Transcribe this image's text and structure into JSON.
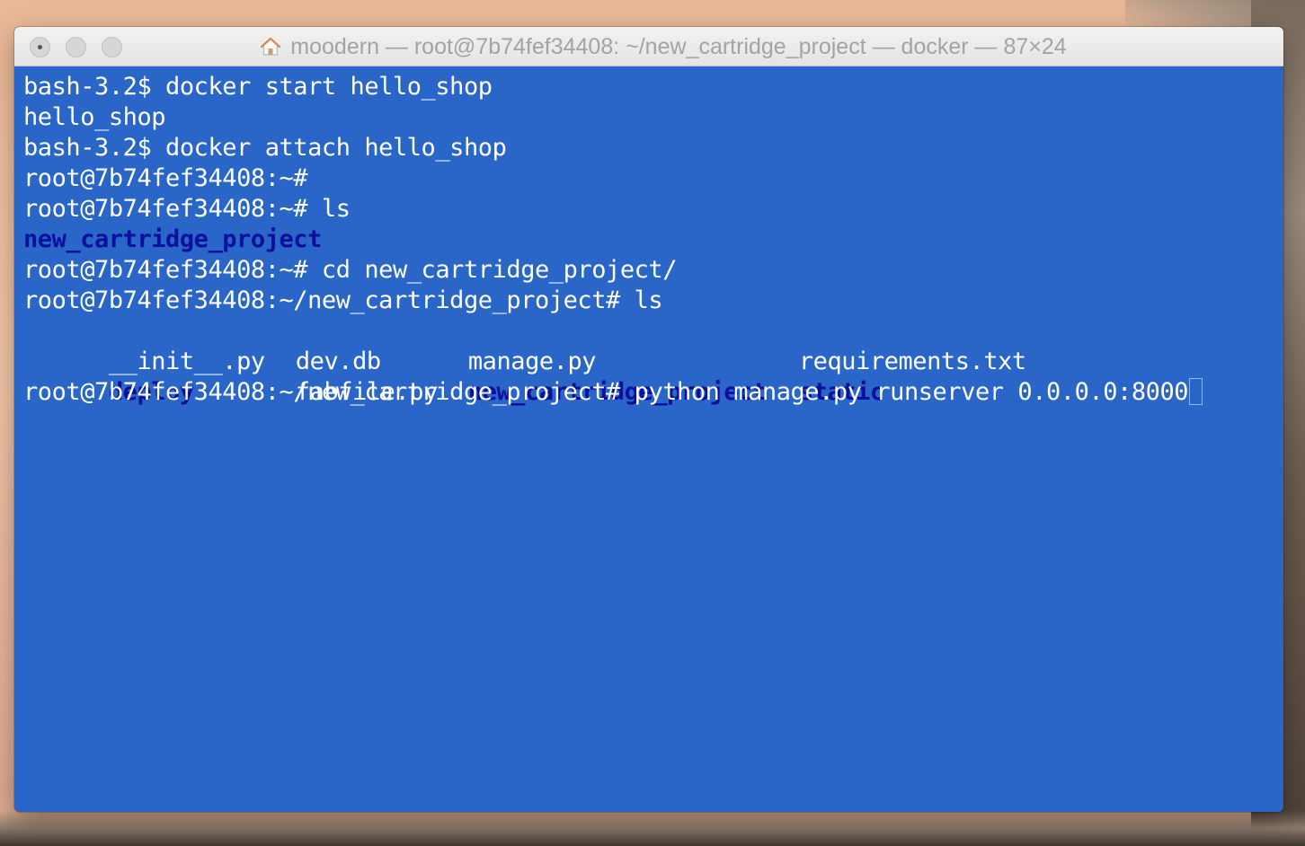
{
  "window": {
    "title": "moodern — root@7b74fef34408: ~/new_cartridge_project — docker — 87×24"
  },
  "icons": {
    "home": "home-folder-icon"
  },
  "colors": {
    "terminal_background": "#2a65c8",
    "terminal_foreground": "#ffffff",
    "directory_color": "#0a0f9e",
    "titlebar_text": "#a3a3a3"
  },
  "terminal": {
    "lines": [
      "bash-3.2$ docker start hello_shop",
      "hello_shop",
      "bash-3.2$ docker attach hello_shop",
      "root@7b74fef34408:~#",
      "root@7b74fef34408:~# ls",
      "new_cartridge_project",
      "root@7b74fef34408:~# cd new_cartridge_project/",
      "root@7b74fef34408:~/new_cartridge_project# ls"
    ],
    "listing": {
      "row1": [
        "__init__.py",
        "dev.db",
        "manage.py",
        "requirements.txt"
      ],
      "row2": [
        "deploy",
        "fabfile.py",
        "new_cartridge_project",
        "static"
      ]
    },
    "current_prompt": "root@7b74fef34408:~/new_cartridge_project#",
    "current_command": "python manage.py runserver 0.0.0.0:8000"
  }
}
